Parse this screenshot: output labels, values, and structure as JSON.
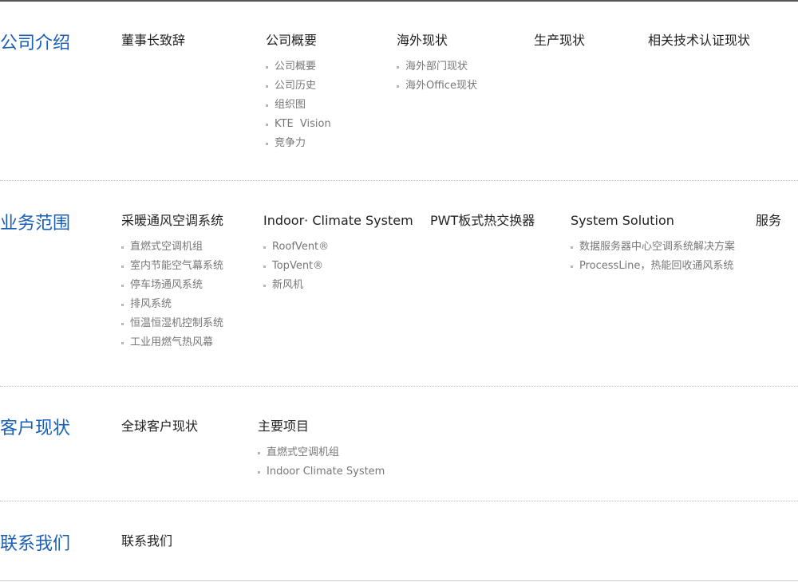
{
  "sections": [
    {
      "title": "公司介绍",
      "columns": [
        {
          "heading": "董事长致辞",
          "items": []
        },
        {
          "heading": "公司概要",
          "items": [
            "公司概要",
            "公司历史",
            "组织图",
            "KTE  Vision",
            "竞争力"
          ]
        },
        {
          "heading": "海外现状",
          "items": [
            "海外部门现状",
            "海外Office现状"
          ]
        },
        {
          "heading": "生产现状",
          "items": []
        },
        {
          "heading": "相关技术认证现状",
          "items": []
        }
      ]
    },
    {
      "title": "业务范围",
      "columns": [
        {
          "heading": "采暖通风空调系统",
          "items": [
            "直燃式空调机组",
            "室内节能空气幕系统",
            "停车场通风系统",
            "排风系统",
            "恒温恒湿机控制系统",
            "工业用燃气热风幕"
          ]
        },
        {
          "heading": "Indoor· Climate System",
          "items": [
            "RoofVent®",
            "TopVent®",
            "新风机"
          ]
        },
        {
          "heading": "PWT板式热交换器",
          "items": []
        },
        {
          "heading": "System Solution",
          "items": [
            "数据服务器中心空调系统解决方案",
            "ProcessLine，热能回收通风系统"
          ]
        },
        {
          "heading": "服务",
          "items": []
        }
      ]
    },
    {
      "title": "客户现状",
      "columns": [
        {
          "heading": "全球客户现状",
          "items": []
        },
        {
          "heading": "主要项目",
          "items": [
            "直燃式空调机组",
            "Indoor Climate System"
          ]
        }
      ]
    },
    {
      "title": "联系我们",
      "columns": [
        {
          "heading": "联系我们",
          "items": []
        }
      ]
    }
  ],
  "colors": {
    "section_title": "#1a5fb4",
    "heading": "#222222",
    "sub_item": "#777777",
    "bullet": "#b5b5b5"
  }
}
